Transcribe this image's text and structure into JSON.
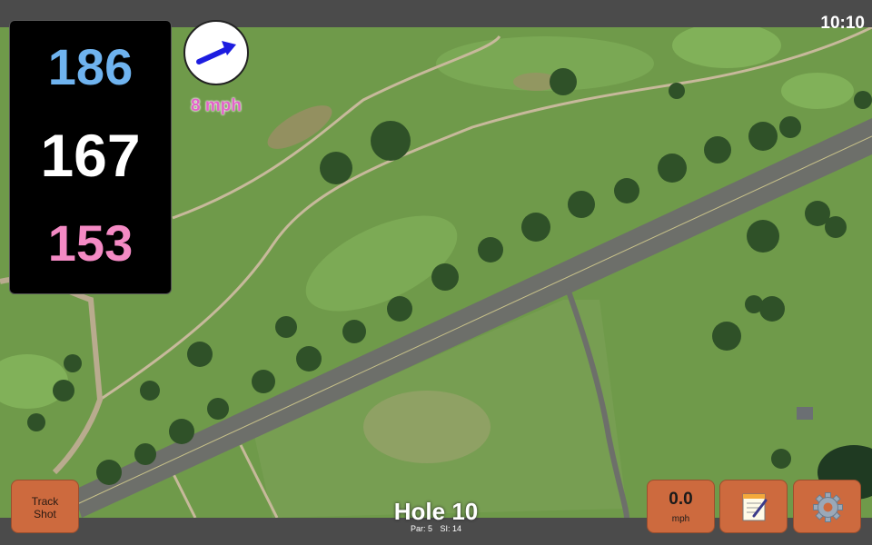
{
  "status": {
    "clock": "10:10"
  },
  "distances": {
    "back": "186",
    "middle": "167",
    "front": "153"
  },
  "wind": {
    "speed": "8 mph",
    "direction_icon": "wind-arrow-icon"
  },
  "buttons": {
    "track_shot": "Track\nShot",
    "speed_value": "0.0",
    "speed_unit": "mph",
    "notes_icon": "notepad-icon",
    "settings_icon": "gear-icon"
  },
  "hole": {
    "title": "Hole 10",
    "par": "Par: 5",
    "si": "SI: 14"
  },
  "colors": {
    "back_distance": "#6fb3ef",
    "middle_distance": "#ffffff",
    "front_distance": "#f48ac4",
    "button_bg": "#cd6a3e",
    "wind_text": "#e264c8"
  }
}
